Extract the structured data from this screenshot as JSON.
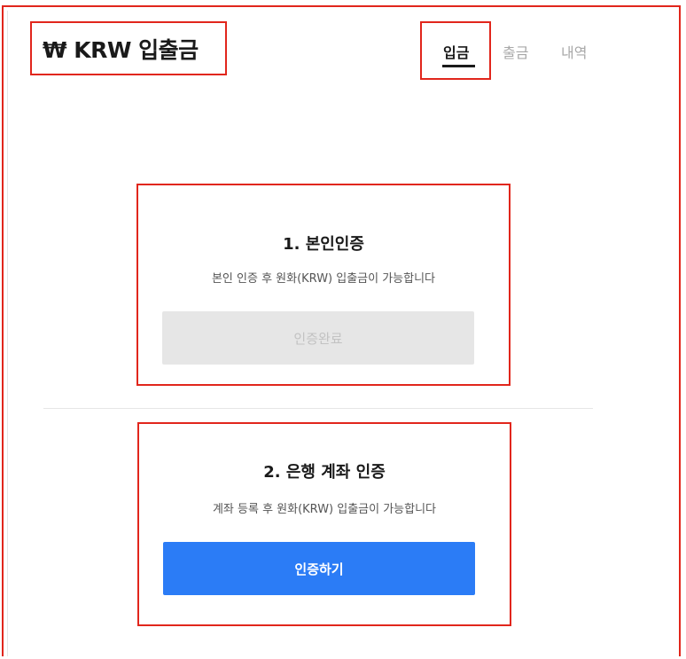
{
  "header": {
    "title": "₩ KRW 입출금"
  },
  "tabs": [
    {
      "label": "입금",
      "active": true
    },
    {
      "label": "출금",
      "active": false
    },
    {
      "label": "내역",
      "active": false
    }
  ],
  "steps": [
    {
      "title": "1. 본인인증",
      "description": "본인 인증 후 원화(KRW) 입출금이 가능합니다",
      "button_label": "인증완료",
      "button_state": "disabled"
    },
    {
      "title": "2. 은행 계좌 인증",
      "description": "계좌 등록 후 원화(KRW) 입출금이 가능합니다",
      "button_label": "인증하기",
      "button_state": "enabled"
    }
  ],
  "colors": {
    "highlight_border": "#e1261c",
    "primary_button": "#2b7cf6",
    "disabled_button": "#e6e6e6",
    "inactive_tab": "#a8a8a8"
  }
}
